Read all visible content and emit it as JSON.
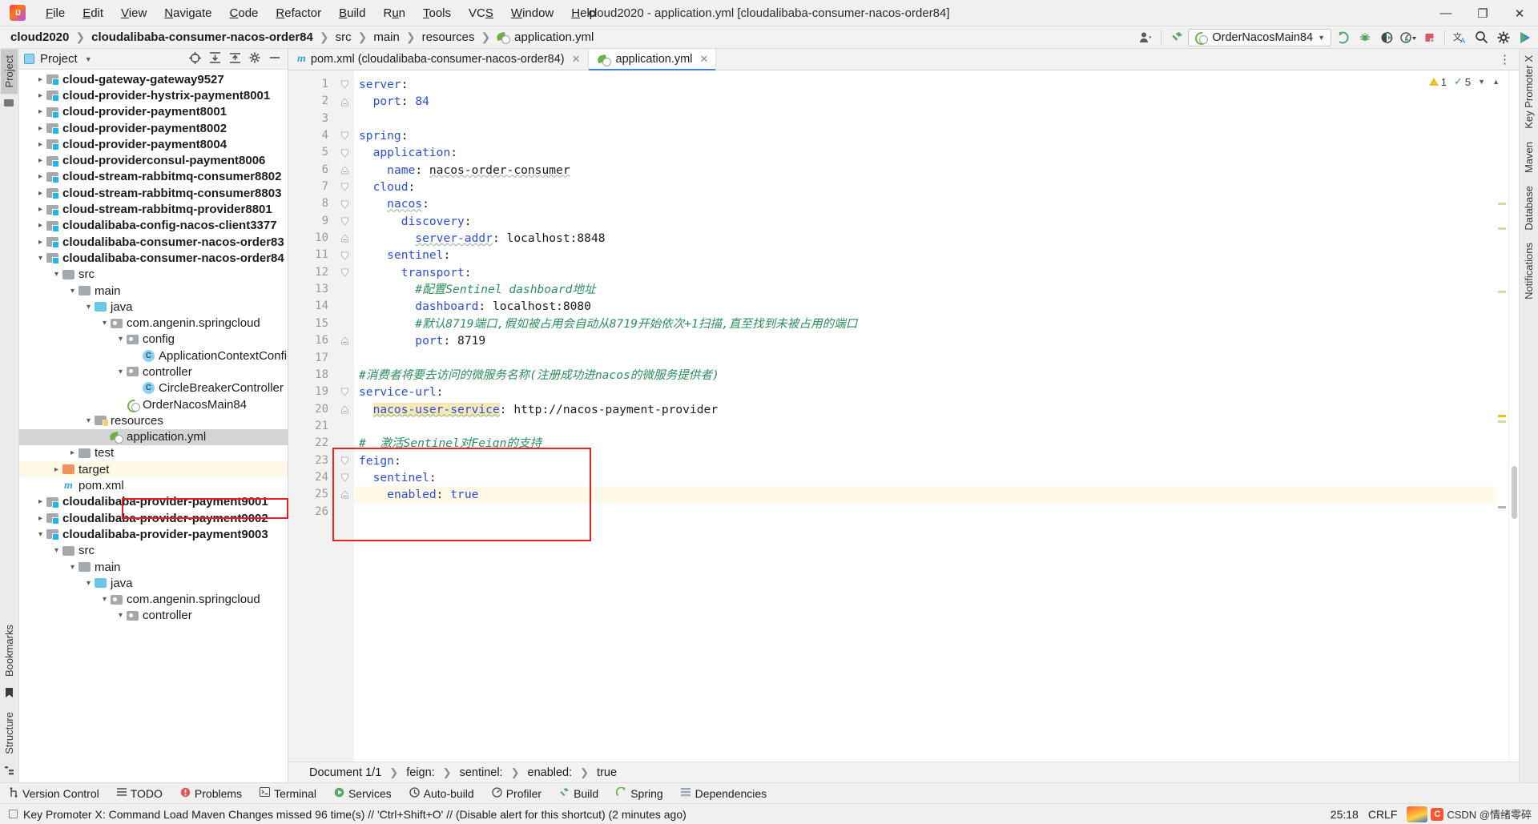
{
  "window": {
    "title": "cloud2020 - application.yml [cloudalibaba-consumer-nacos-order84]",
    "minimize": "—",
    "maximize": "❐",
    "close": "✕"
  },
  "menu": [
    {
      "label": "File"
    },
    {
      "label": "Edit"
    },
    {
      "label": "View"
    },
    {
      "label": "Navigate"
    },
    {
      "label": "Code"
    },
    {
      "label": "Refactor"
    },
    {
      "label": "Build"
    },
    {
      "label": "Run"
    },
    {
      "label": "Tools"
    },
    {
      "label": "VCS"
    },
    {
      "label": "Window"
    },
    {
      "label": "Help"
    }
  ],
  "breadcrumb": [
    {
      "label": "cloud2020",
      "bold": true
    },
    {
      "label": "cloudalibaba-consumer-nacos-order84",
      "bold": true
    },
    {
      "label": "src",
      "bold": false
    },
    {
      "label": "main",
      "bold": false
    },
    {
      "label": "resources",
      "bold": false
    },
    {
      "label": "application.yml",
      "bold": false,
      "icon": "yml-icon"
    }
  ],
  "toolbar": {
    "avatar_icon": "user-avatar-icon",
    "hammer_icon": "build-hammer-icon",
    "run_config": "OrderNacosMain84",
    "run_config_icon": "spring-boot-icon",
    "run_icon": "run-icon",
    "debug_icon": "debug-icon",
    "coverage_icon": "run-with-coverage-icon",
    "profiler_icon": "profiler-icon",
    "stop_icon": "stop-icon",
    "translate_icon": "translate-icon",
    "search_icon": "search-everywhere-icon",
    "settings_icon": "settings-gear-icon",
    "ide_icon": "ide-action-icon"
  },
  "left_strip": {
    "tabs": [
      {
        "label": "Project",
        "active": true
      },
      {
        "label": "Bookmarks",
        "active": false
      },
      {
        "label": "Structure",
        "active": false
      }
    ]
  },
  "right_strip": {
    "tabs": [
      {
        "label": "Key Promoter X"
      },
      {
        "label": "Maven"
      },
      {
        "label": "Database"
      },
      {
        "label": "Notifications"
      }
    ]
  },
  "project_panel": {
    "title": "Project",
    "icons": [
      "locate-icon",
      "expand-all-icon",
      "collapse-all-icon",
      "gear-icon",
      "minimize-icon"
    ],
    "tree": [
      {
        "label": "cloud-gateway-gateway9527",
        "depth": 1,
        "arrow": "collapsed",
        "icon": "module-folder",
        "bold": true
      },
      {
        "label": "cloud-provider-hystrix-payment8001",
        "depth": 1,
        "arrow": "collapsed",
        "icon": "module-folder",
        "bold": true
      },
      {
        "label": "cloud-provider-payment8001",
        "depth": 1,
        "arrow": "collapsed",
        "icon": "module-folder",
        "bold": true
      },
      {
        "label": "cloud-provider-payment8002",
        "depth": 1,
        "arrow": "collapsed",
        "icon": "module-folder",
        "bold": true
      },
      {
        "label": "cloud-provider-payment8004",
        "depth": 1,
        "arrow": "collapsed",
        "icon": "module-folder",
        "bold": true
      },
      {
        "label": "cloud-providerconsul-payment8006",
        "depth": 1,
        "arrow": "collapsed",
        "icon": "module-folder",
        "bold": true
      },
      {
        "label": "cloud-stream-rabbitmq-consumer8802",
        "depth": 1,
        "arrow": "collapsed",
        "icon": "module-folder",
        "bold": true
      },
      {
        "label": "cloud-stream-rabbitmq-consumer8803",
        "depth": 1,
        "arrow": "collapsed",
        "icon": "module-folder",
        "bold": true
      },
      {
        "label": "cloud-stream-rabbitmq-provider8801",
        "depth": 1,
        "arrow": "collapsed",
        "icon": "module-folder",
        "bold": true
      },
      {
        "label": "cloudalibaba-config-nacos-client3377",
        "depth": 1,
        "arrow": "collapsed",
        "icon": "module-folder",
        "bold": true
      },
      {
        "label": "cloudalibaba-consumer-nacos-order83",
        "depth": 1,
        "arrow": "collapsed",
        "icon": "module-folder",
        "bold": true
      },
      {
        "label": "cloudalibaba-consumer-nacos-order84",
        "depth": 1,
        "arrow": "expanded",
        "icon": "module-folder",
        "bold": true
      },
      {
        "label": "src",
        "depth": 2,
        "arrow": "expanded",
        "icon": "plain-folder",
        "bold": false
      },
      {
        "label": "main",
        "depth": 3,
        "arrow": "expanded",
        "icon": "plain-folder",
        "bold": false
      },
      {
        "label": "java",
        "depth": 4,
        "arrow": "expanded",
        "icon": "source-folder",
        "bold": false
      },
      {
        "label": "com.angenin.springcloud",
        "depth": 5,
        "arrow": "expanded",
        "icon": "package",
        "bold": false
      },
      {
        "label": "config",
        "depth": 6,
        "arrow": "expanded",
        "icon": "package",
        "bold": false
      },
      {
        "label": "ApplicationContextConfig",
        "depth": 7,
        "arrow": "none",
        "icon": "class",
        "bold": false
      },
      {
        "label": "controller",
        "depth": 6,
        "arrow": "expanded",
        "icon": "package",
        "bold": false
      },
      {
        "label": "CircleBreakerController",
        "depth": 7,
        "arrow": "none",
        "icon": "class",
        "bold": false
      },
      {
        "label": "OrderNacosMain84",
        "depth": 6,
        "arrow": "none",
        "icon": "spring-boot",
        "bold": false
      },
      {
        "label": "resources",
        "depth": 4,
        "arrow": "expanded",
        "icon": "resource-folder",
        "bold": false
      },
      {
        "label": "application.yml",
        "depth": 5,
        "arrow": "none",
        "icon": "yml",
        "bold": false,
        "selected": true
      },
      {
        "label": "test",
        "depth": 3,
        "arrow": "collapsed",
        "icon": "plain-folder",
        "bold": false
      },
      {
        "label": "target",
        "depth": 2,
        "arrow": "collapsed",
        "icon": "target-folder",
        "bold": false,
        "highlight": true
      },
      {
        "label": "pom.xml",
        "depth": 2,
        "arrow": "none",
        "icon": "maven",
        "bold": false
      },
      {
        "label": "cloudalibaba-provider-payment9001",
        "depth": 1,
        "arrow": "collapsed",
        "icon": "module-folder",
        "bold": true
      },
      {
        "label": "cloudalibaba-provider-payment9002",
        "depth": 1,
        "arrow": "collapsed",
        "icon": "module-folder",
        "bold": true
      },
      {
        "label": "cloudalibaba-provider-payment9003",
        "depth": 1,
        "arrow": "expanded",
        "icon": "module-folder",
        "bold": true
      },
      {
        "label": "src",
        "depth": 2,
        "arrow": "expanded",
        "icon": "plain-folder",
        "bold": false
      },
      {
        "label": "main",
        "depth": 3,
        "arrow": "expanded",
        "icon": "plain-folder",
        "bold": false
      },
      {
        "label": "java",
        "depth": 4,
        "arrow": "expanded",
        "icon": "source-folder",
        "bold": false
      },
      {
        "label": "com.angenin.springcloud",
        "depth": 5,
        "arrow": "expanded",
        "icon": "package",
        "bold": false
      },
      {
        "label": "controller",
        "depth": 6,
        "arrow": "expanded",
        "icon": "package",
        "bold": false
      }
    ]
  },
  "editor": {
    "tabs": [
      {
        "label": "pom.xml (cloudalibaba-consumer-nacos-order84)",
        "icon": "maven-icon",
        "active": false,
        "close": "✕"
      },
      {
        "label": "application.yml",
        "icon": "yml-icon",
        "active": true,
        "close": "✕"
      }
    ],
    "overflow_icon": "more-options-icon",
    "inspection": {
      "warnings": "1",
      "weak_warnings": "5",
      "warning_icon": "warning-triangle-icon",
      "check_icon": "inspection-check-icon",
      "caret_icon": "chevron-down-icon"
    },
    "line_numbers": [
      "1",
      "2",
      "3",
      "4",
      "5",
      "6",
      "7",
      "8",
      "9",
      "10",
      "11",
      "12",
      "13",
      "14",
      "15",
      "16",
      "17",
      "18",
      "19",
      "20",
      "21",
      "22",
      "23",
      "24",
      "25",
      "26"
    ],
    "code_lines": [
      {
        "n": 1,
        "indent": 0,
        "fold": "tri",
        "segs": [
          {
            "t": "server",
            "c": "k"
          },
          {
            "t": ":",
            "c": "v"
          }
        ]
      },
      {
        "n": 2,
        "indent": 1,
        "fold": "box",
        "segs": [
          {
            "t": "port",
            "c": "k"
          },
          {
            "t": ": ",
            "c": "v"
          },
          {
            "t": "84",
            "c": "k"
          }
        ]
      },
      {
        "n": 3,
        "indent": 0,
        "fold": "none",
        "segs": []
      },
      {
        "n": 4,
        "indent": 0,
        "fold": "tri",
        "segs": [
          {
            "t": "spring",
            "c": "k"
          },
          {
            "t": ":",
            "c": "v"
          }
        ]
      },
      {
        "n": 5,
        "indent": 1,
        "fold": "tri",
        "segs": [
          {
            "t": "application",
            "c": "k"
          },
          {
            "t": ":",
            "c": "v"
          }
        ]
      },
      {
        "n": 6,
        "indent": 2,
        "fold": "box",
        "segs": [
          {
            "t": "name",
            "c": "k"
          },
          {
            "t": ": ",
            "c": "v"
          },
          {
            "t": "nacos-order-consumer",
            "c": "v wavy"
          }
        ]
      },
      {
        "n": 7,
        "indent": 1,
        "fold": "tri",
        "segs": [
          {
            "t": "cloud",
            "c": "k"
          },
          {
            "t": ":",
            "c": "v"
          }
        ]
      },
      {
        "n": 8,
        "indent": 2,
        "fold": "tri",
        "segs": [
          {
            "t": "nacos",
            "c": "k wavy"
          },
          {
            "t": ":",
            "c": "v"
          }
        ]
      },
      {
        "n": 9,
        "indent": 3,
        "fold": "tri",
        "segs": [
          {
            "t": "discovery",
            "c": "k"
          },
          {
            "t": ":",
            "c": "v"
          }
        ]
      },
      {
        "n": 10,
        "indent": 4,
        "fold": "box",
        "segs": [
          {
            "t": "server-addr",
            "c": "k wavy"
          },
          {
            "t": ": ",
            "c": "v"
          },
          {
            "t": "localhost:8848",
            "c": "v"
          }
        ]
      },
      {
        "n": 11,
        "indent": 2,
        "fold": "tri",
        "segs": [
          {
            "t": "sentinel",
            "c": "k"
          },
          {
            "t": ":",
            "c": "v"
          }
        ]
      },
      {
        "n": 12,
        "indent": 3,
        "fold": "tri",
        "segs": [
          {
            "t": "transport",
            "c": "k"
          },
          {
            "t": ":",
            "c": "v"
          }
        ]
      },
      {
        "n": 13,
        "indent": 4,
        "fold": "none",
        "segs": [
          {
            "t": "#配置Sentinel dashboard地址",
            "c": "cm"
          }
        ]
      },
      {
        "n": 14,
        "indent": 4,
        "fold": "none",
        "segs": [
          {
            "t": "dashboard",
            "c": "k"
          },
          {
            "t": ": ",
            "c": "v"
          },
          {
            "t": "localhost:8080",
            "c": "v"
          }
        ]
      },
      {
        "n": 15,
        "indent": 4,
        "fold": "none",
        "segs": [
          {
            "t": "#默认8719端口,假如被占用会自动从8719开始依次+1扫描,直至找到未被占用的端口",
            "c": "cm"
          }
        ]
      },
      {
        "n": 16,
        "indent": 4,
        "fold": "box",
        "segs": [
          {
            "t": "port",
            "c": "k"
          },
          {
            "t": ": ",
            "c": "v"
          },
          {
            "t": "8719",
            "c": "v"
          }
        ]
      },
      {
        "n": 17,
        "indent": 0,
        "fold": "none",
        "segs": []
      },
      {
        "n": 18,
        "indent": 0,
        "fold": "none",
        "segs": [
          {
            "t": "#消费者将要去访问的微服务名称(注册成功进nacos的微服务提供者)",
            "c": "cm"
          }
        ]
      },
      {
        "n": 19,
        "indent": 0,
        "fold": "tri",
        "segs": [
          {
            "t": "service-url",
            "c": "k"
          },
          {
            "t": ":",
            "c": "v"
          }
        ]
      },
      {
        "n": 20,
        "indent": 1,
        "fold": "box",
        "segs": [
          {
            "t": "nacos-user-service",
            "c": "k hlval wavy"
          },
          {
            "t": ": ",
            "c": "v"
          },
          {
            "t": "http://nacos-payment-provider",
            "c": "v"
          }
        ]
      },
      {
        "n": 21,
        "indent": 0,
        "fold": "none",
        "segs": []
      },
      {
        "n": 22,
        "indent": 0,
        "fold": "none",
        "segs": [
          {
            "t": "#  激活Sentinel对Feign的支持",
            "c": "cm"
          }
        ]
      },
      {
        "n": 23,
        "indent": 0,
        "fold": "tri",
        "segs": [
          {
            "t": "feign",
            "c": "k"
          },
          {
            "t": ":",
            "c": "v"
          }
        ]
      },
      {
        "n": 24,
        "indent": 1,
        "fold": "tri",
        "segs": [
          {
            "t": "sentinel",
            "c": "k"
          },
          {
            "t": ":",
            "c": "v"
          }
        ]
      },
      {
        "n": 25,
        "indent": 2,
        "fold": "box",
        "highlight": true,
        "segs": [
          {
            "t": "enabled",
            "c": "k"
          },
          {
            "t": ": ",
            "c": "v"
          },
          {
            "t": "true",
            "c": "k"
          }
        ]
      },
      {
        "n": 26,
        "indent": 0,
        "fold": "none",
        "segs": []
      }
    ],
    "footer_crumbs": [
      "Document 1/1",
      "feign:",
      "sentinel:",
      "enabled:",
      "true"
    ]
  },
  "tool_windows": [
    {
      "label": "Version Control",
      "icon": "branch-icon"
    },
    {
      "label": "TODO",
      "icon": "list-icon"
    },
    {
      "label": "Problems",
      "icon": "problems-icon"
    },
    {
      "label": "Terminal",
      "icon": "terminal-icon"
    },
    {
      "label": "Services",
      "icon": "services-icon"
    },
    {
      "label": "Auto-build",
      "icon": "autobuild-icon"
    },
    {
      "label": "Profiler",
      "icon": "profiler-icon"
    },
    {
      "label": "Build",
      "icon": "build-icon"
    },
    {
      "label": "Spring",
      "icon": "spring-icon"
    },
    {
      "label": "Dependencies",
      "icon": "dependencies-icon"
    }
  ],
  "status_bar": {
    "message": "Key Promoter X: Command Load Maven Changes missed 96 time(s) // 'Ctrl+Shift+O' // (Disable alert for this shortcut) (2 minutes ago)",
    "caret_position": "25:18",
    "line_separator": "CRLF",
    "watermark": "CSDN @情绪零碎"
  },
  "colors": {
    "accent_blue": "#4185d9",
    "keyword_blue": "#2a4fd6",
    "comment_green": "#2a8f5e",
    "highlight_red": "#ec2024",
    "selection_gray": "#d4d4d4",
    "line_highlight": "#fffae8",
    "value_highlight": "#f8e8b8"
  }
}
